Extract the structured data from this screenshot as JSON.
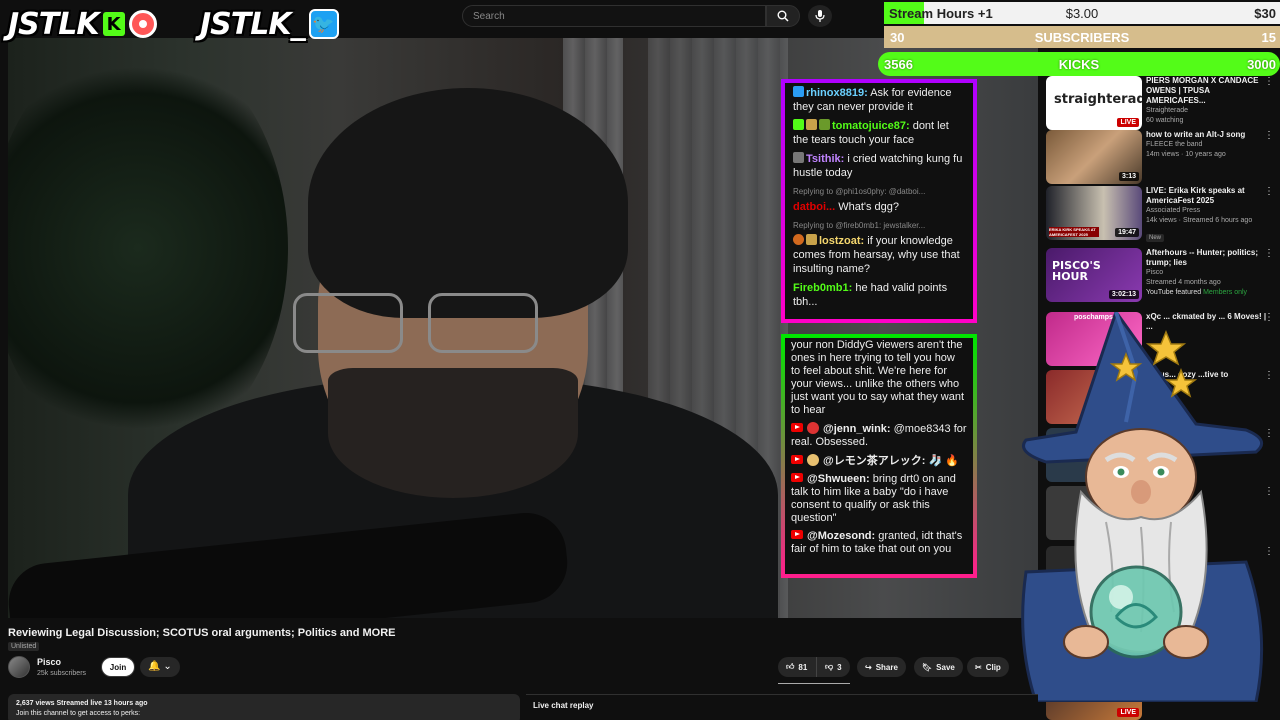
{
  "overlay": {
    "kick_logo": "JSTLK",
    "kick_badge": "K",
    "twitter_logo": "JSTLK_",
    "twitter_badge": "🐦"
  },
  "search": {
    "placeholder": "Search"
  },
  "goals": [
    {
      "left": "Stream Hours +1",
      "center": "$3.00",
      "right": "$30",
      "progress": 0.1
    },
    {
      "left": "30",
      "center": "SUBSCRIBERS",
      "right": "15"
    },
    {
      "left": "3566",
      "center": "KICKS",
      "right": "3000"
    }
  ],
  "chat_top": [
    {
      "user": "rhinox8819:",
      "text": " Ask for evidence they can never provide it",
      "color": "#6bd1ff",
      "reply": ""
    },
    {
      "user": "tomatojuice87:",
      "text": " dont let the tears touch your face",
      "color": "#53fc18",
      "reply": ""
    },
    {
      "user": "Tsithik:",
      "text": " i cried watching kung fu hustle today",
      "color": "#c084ff",
      "reply": ""
    },
    {
      "user": "datboi...",
      "text": " What's dgg?",
      "color": "#e00000",
      "reply": "Replying to @phi1os0phy: @datboi..."
    },
    {
      "user": "lostzoat:",
      "text": " if your knowledge comes from hearsay, why use that insulting name?",
      "color": "#f5d76e",
      "reply": "Replying to @fireb0mb1: jewstalker..."
    },
    {
      "user": "Fireb0mb1:",
      "text": " he had valid points tbh...",
      "color": "#53fc18",
      "reply": ""
    }
  ],
  "chat_bottom": [
    {
      "user": "",
      "text": "your non DiddyG viewers aren't the ones in here trying to tell you how to feel about shit. We're here for your views... unlike the others who just want you to say what they want to hear"
    },
    {
      "user": "@jenn_wink:",
      "text": " @moe8343 for real. Obsessed."
    },
    {
      "user": "@レモン茶アレック:",
      "text": " 🧦 🔥"
    },
    {
      "user": "@Shwueen:",
      "text": " bring drt0 on and talk to him like a baby \"do i have consent to qualify or ask this question\""
    },
    {
      "user": "@Mozesond:",
      "text": " granted, idt that's fair of him to take that out on you"
    }
  ],
  "sidebar": [
    {
      "title": "PIERS MORGAN X CANDACE OWENS | TPUSA AMERICAFES...",
      "channel": "Straighterade",
      "meta": "60 watching",
      "thumb_text": "straighterade.",
      "tag": "LIVE"
    },
    {
      "title": "how to write an Alt-J song",
      "channel": "FLEECE the band",
      "meta": "14m views · 10 years ago",
      "thumb_text": "",
      "tag": "3:13"
    },
    {
      "title": "LIVE: Erika Kirk speaks at AmericaFest 2025",
      "channel": "Associated Press",
      "meta": "14k views · Streamed 6 hours ago",
      "thumb_text": "ERIKA KIRK SPEAKS AT AMERICAFEST 2025",
      "tag": "19:47",
      "badge": "New"
    },
    {
      "title": "Afterhours -- Hunter; politics; trump; lies",
      "channel": "Pisco",
      "meta": "Streamed 4 months ago",
      "thumb_text": "PISCO'S HOUR",
      "tag": "3:02:13",
      "badge": "YouTube featured",
      "badge2": "Members only"
    },
    {
      "title": "xQc ... ckmated by ... 6 Moves! | ...",
      "channel": "",
      "meta": "",
      "thumb_text": "poschamps",
      "tag": ""
    },
    {
      "title": "...mus... cozy ...tive to",
      "channel": "",
      "meta": "",
      "thumb_text": "",
      "tag": ""
    },
    {
      "title": "...s Alex",
      "channel": "",
      "meta": "",
      "thumb_text": "",
      "tag": ""
    },
    {
      "title": "...s Defy",
      "channel": "",
      "meta": "",
      "thumb_text": "",
      "tag": ""
    },
    {
      "title": "...in...",
      "channel": "",
      "meta": "",
      "thumb_text": "",
      "tag": ""
    },
    {
      "title": "",
      "channel": "",
      "meta": "",
      "thumb_text": "",
      "tag": "LIVE"
    }
  ],
  "video": {
    "title": "Reviewing Legal Discussion; SCOTUS oral arguments; Politics and MORE",
    "unlisted": "Unlisted",
    "channel": "Pisco",
    "subs": "25k subscribers",
    "join": "Join",
    "likes": "81",
    "dislikes": "3",
    "share": "Share",
    "save": "Save",
    "clip": "Clip",
    "stats": "2,637 views  Streamed live 13 hours ago",
    "desc": "Join this channel to get access to perks:",
    "chat_replay": "Live chat replay"
  },
  "colors": {
    "kick_green": "#53fc18",
    "subs_tan": "#d6bd8c",
    "youtube_red": "#cc0000"
  }
}
